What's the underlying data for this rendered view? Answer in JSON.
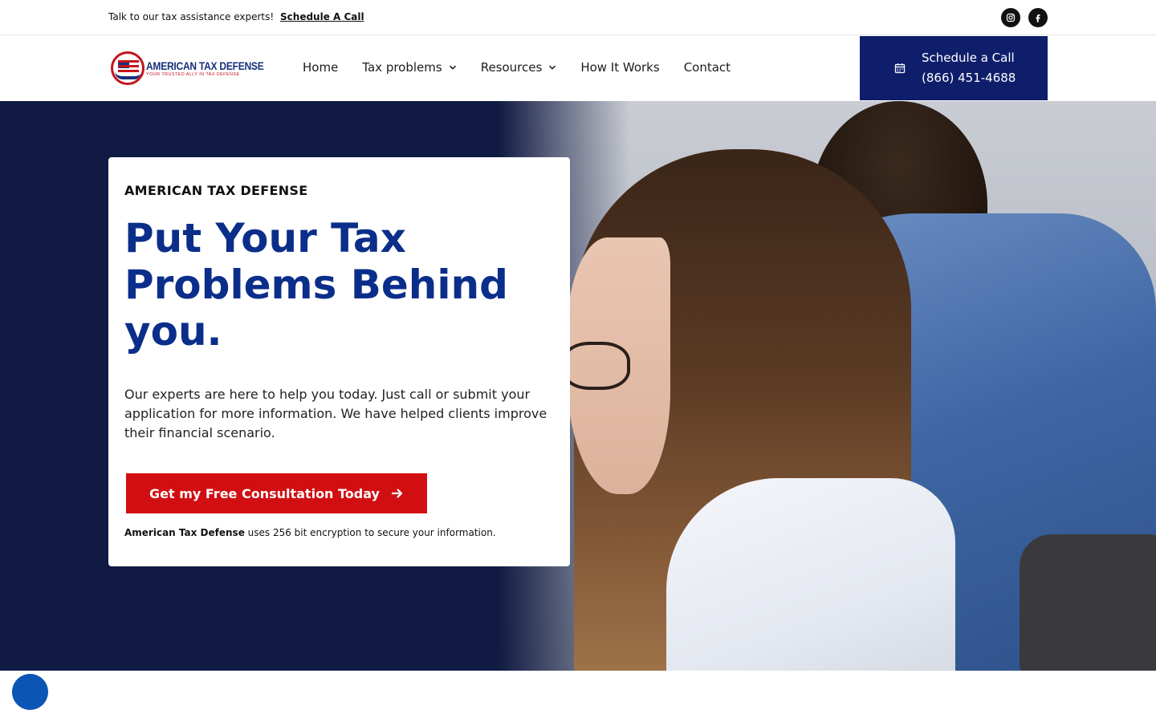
{
  "topbar": {
    "text": "Talk to our tax assistance experts!",
    "link": "Schedule A Call",
    "social": [
      "instagram-icon",
      "facebook-icon"
    ]
  },
  "logo": {
    "title": "AMERICAN TAX DEFENSE",
    "subtitle": "YOUR TRUSTED ALLY IN TAX DEFENSE"
  },
  "nav": {
    "items": [
      {
        "label": "Home",
        "dropdown": false
      },
      {
        "label": "Tax problems",
        "dropdown": true
      },
      {
        "label": "Resources",
        "dropdown": true
      },
      {
        "label": "How It Works",
        "dropdown": false
      },
      {
        "label": "Contact",
        "dropdown": false
      }
    ]
  },
  "header_cta": {
    "line1": "Schedule a Call",
    "line2": "(866) 451-4688",
    "icon": "calendar-icon"
  },
  "hero": {
    "eyebrow": "AMERICAN TAX DEFENSE",
    "headline": "Put Your Tax Problems Behind you.",
    "lead": "Our experts are here to help you today. Just call or submit your application for more information. We have helped clients improve their financial scenario.",
    "button": "Get my Free Consultation Today",
    "secure_bold": "American Tax Defense",
    "secure_text": " uses 256 bit encryption to secure your information."
  },
  "colors": {
    "brand_navy": "#0f1e6b",
    "headline_blue": "#0b2e8a",
    "cta_red": "#d10f12",
    "hero_bg": "#101a42",
    "chat_blue": "#0b56b5"
  }
}
